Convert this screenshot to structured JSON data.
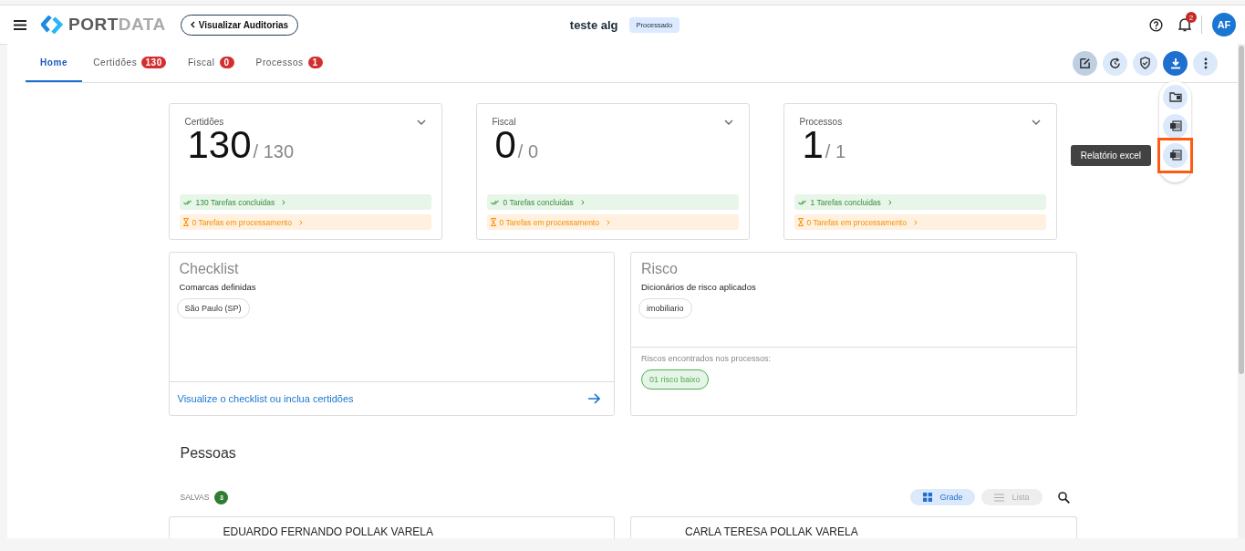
{
  "header": {
    "logo_bold": "PORT",
    "logo_light": "DATA",
    "back_button": "Visualizar Auditorias",
    "title": "teste alg",
    "status": "Processado",
    "notifications_count": "2",
    "avatar": "AF"
  },
  "tabs": [
    {
      "label": "Home",
      "selected": true
    },
    {
      "label": "Certidões",
      "count": "130",
      "selected": false
    },
    {
      "label": "Fiscal",
      "count": "0",
      "selected": false
    },
    {
      "label": "Processos",
      "count": "1",
      "selected": false
    }
  ],
  "toolbar": [
    {
      "kind": "edit",
      "pressed": true
    },
    {
      "kind": "history",
      "pressed": false
    },
    {
      "kind": "shield",
      "pressed": false
    },
    {
      "kind": "download",
      "expanded": true
    },
    {
      "kind": "more",
      "pressed": false
    }
  ],
  "download_menu": {
    "items": [
      {
        "kind": "folder",
        "highlighted": false
      },
      {
        "kind": "word",
        "highlighted": false
      },
      {
        "kind": "excel",
        "highlighted": true
      }
    ],
    "tooltip": "Relatório excel"
  },
  "stats": [
    {
      "label": "Certidões",
      "value": "130",
      "total": "/ 130",
      "done": "130 Tarefas concluidas",
      "processing": "0 Tarefas em processamento"
    },
    {
      "label": "Fiscal",
      "value": "0",
      "total": "/ 0",
      "done": "0 Tarefas concluidas",
      "processing": "0 Tarefas em processamento"
    },
    {
      "label": "Processos",
      "value": "1",
      "total": "/ 1",
      "done": "1 Tarefas concluidas",
      "processing": "0 Tarefas em processamento"
    }
  ],
  "checklist": {
    "title": "Checklist",
    "subtitle": "Comarcas definidas",
    "chips": [
      "São Paulo (SP)"
    ],
    "link": "Visualize o checklist ou inclua certidões"
  },
  "risk": {
    "title": "Risco",
    "subtitle": "Dicionários de risco aplicados",
    "chips": [
      "imobiliario"
    ],
    "found_label": "Riscos encontrados nos processos:",
    "found": [
      {
        "label": "01 risco baixo",
        "color": "#4caf50"
      }
    ]
  },
  "people": {
    "title": "Pessoas",
    "saved_label": "SALVAS",
    "saved_count": "3",
    "views": [
      {
        "label": "Grade",
        "selected": true
      },
      {
        "label": "Lista",
        "selected": false
      }
    ],
    "cards": [
      "EDUARDO FERNANDO POLLAK VARELA",
      "CARLA TERESA POLLAK VARELA"
    ]
  }
}
